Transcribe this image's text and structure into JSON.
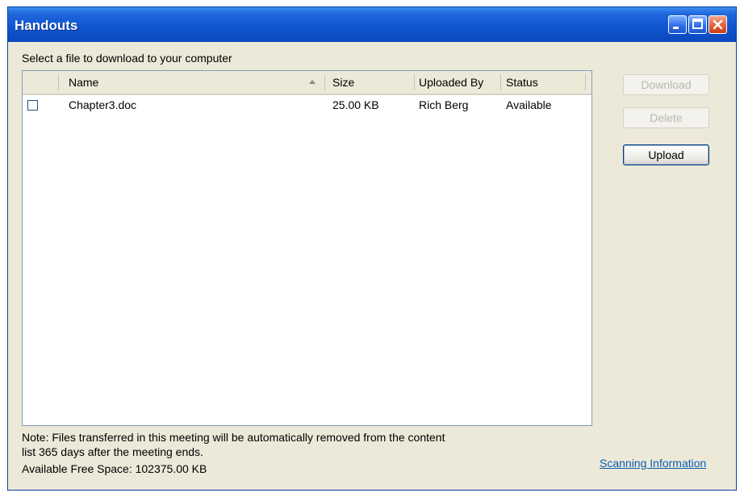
{
  "window": {
    "title": "Handouts"
  },
  "titlebar_buttons": {
    "minimize_icon": "minimize-icon",
    "maximize_icon": "maximize-icon",
    "close_icon": "close-icon"
  },
  "prompt": "Select a file to download to your computer",
  "table": {
    "columns": [
      "Name",
      "Size",
      "Uploaded By",
      "Status"
    ],
    "sort": {
      "column": "Name",
      "direction": "ascending"
    },
    "rows": [
      {
        "checked": false,
        "name": "Chapter3.doc",
        "size": "25.00 KB",
        "uploaded_by": "Rich Berg",
        "status": "Available"
      }
    ]
  },
  "buttons": {
    "download": "Download",
    "delete": "Delete",
    "upload": "Upload"
  },
  "note": {
    "line1": "Note: Files transferred in this meeting will be automatically removed from the content",
    "line2": "list 365 days after the meeting ends."
  },
  "free_space": "Available Free Space: 102375.00 KB",
  "scanning_link": "Scanning Information",
  "colors": {
    "titlebar": "#0f54cf",
    "window_bg": "#ece9d8",
    "link": "#0b5db5",
    "close_button": "#e3592f"
  }
}
